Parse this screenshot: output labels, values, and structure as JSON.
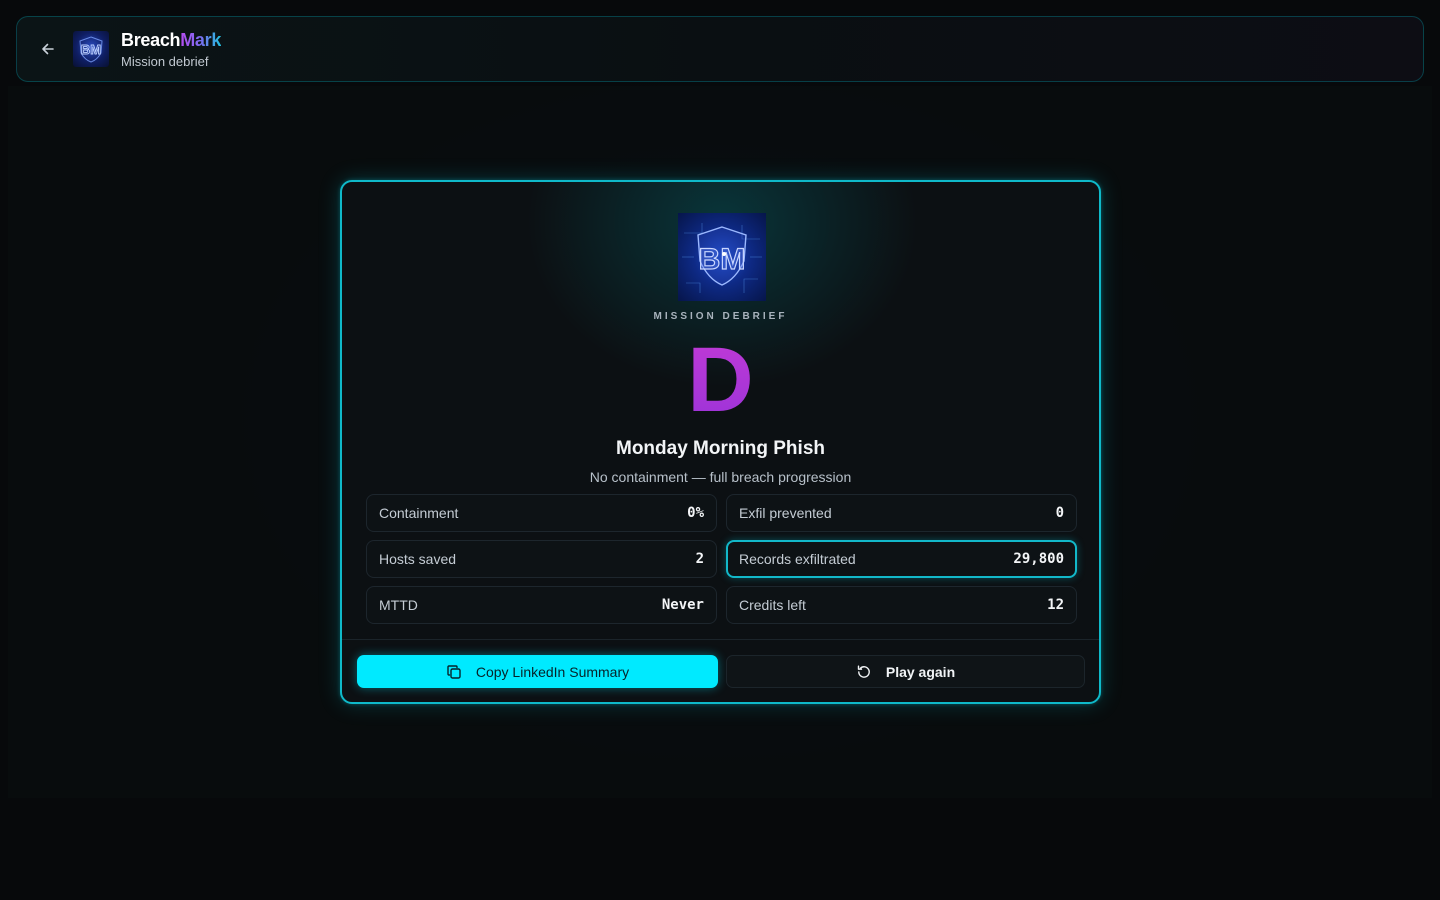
{
  "header": {
    "brand_part1": "Breach",
    "brand_part2": "Mark",
    "subtitle": "Mission debrief",
    "logo_monogram": "BM"
  },
  "debrief": {
    "kicker": "MISSION DEBRIEF",
    "grade": "D",
    "title": "Monday Morning Phish",
    "summary": "No containment — full breach progression"
  },
  "stats": [
    {
      "label": "Containment",
      "value": "0%"
    },
    {
      "label": "Exfil prevented",
      "value": "0"
    },
    {
      "label": "Hosts saved",
      "value": "2"
    },
    {
      "label": "Records exfiltrated",
      "value": "29,800"
    },
    {
      "label": "MTTD",
      "value": "Never"
    },
    {
      "label": "Credits left",
      "value": "12"
    }
  ],
  "actions": {
    "copy_label": "Copy LinkedIn Summary",
    "play_again_label": "Play again"
  },
  "colors": {
    "accent": "#00eaff",
    "grade": "#b036d8",
    "card_border": "#0fb9c9"
  },
  "icons": {
    "back": "arrow-left-icon",
    "copy": "copy-icon",
    "replay": "rotate-ccw-icon"
  }
}
